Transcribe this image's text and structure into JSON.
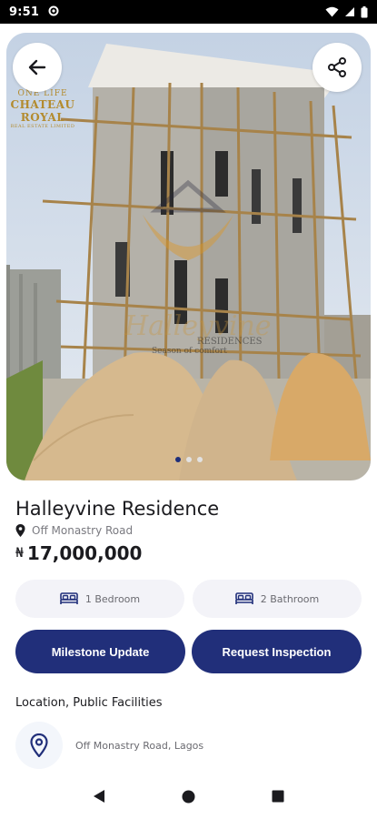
{
  "status_bar": {
    "time": "9:51",
    "icons": [
      "settings-icon",
      "wifi-icon",
      "signal-icon",
      "battery-icon"
    ]
  },
  "hero": {
    "images_count": 3,
    "active_index": 0,
    "watermark": {
      "logo_top": "ONE LIFE",
      "logo_name": "CHATEAU ROYAL",
      "logo_sub": "REAL ESTATE LIMITED",
      "center_name": "Halleyvine",
      "center_sub": "RESIDENCES",
      "center_tag": "Season of comfort"
    }
  },
  "property": {
    "title": "Halleyvine Residence",
    "address": "Off Monastry Road",
    "currency_symbol": "₦",
    "price": "17,000,000"
  },
  "features": {
    "bedroom": "1 Bedroom",
    "bathroom": "2 Bathroom"
  },
  "actions": {
    "milestone": "Milestone Update",
    "inspection": "Request Inspection"
  },
  "location": {
    "section_title": "Location, Public Facilities",
    "address": "Off Monastry Road, Lagos"
  },
  "colors": {
    "primary": "#212f7a",
    "pill_bg": "#f3f3f8",
    "text_muted": "#7a7a80"
  }
}
